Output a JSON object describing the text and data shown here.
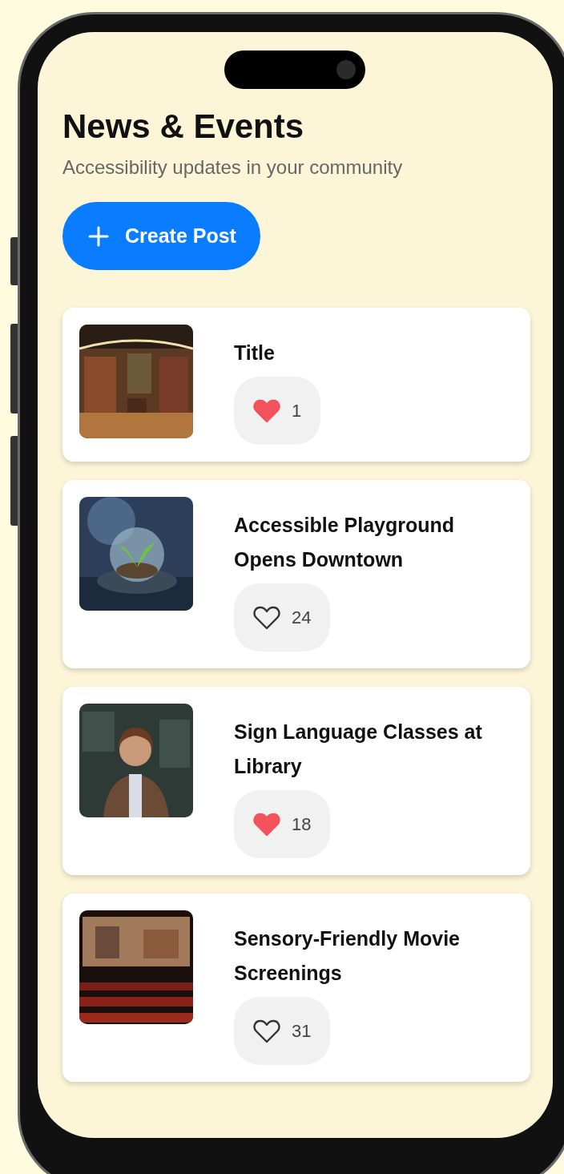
{
  "header": {
    "title": "News & Events",
    "subtitle": "Accessibility updates in your community"
  },
  "create_button": {
    "label": "Create Post"
  },
  "posts": [
    {
      "title": "Title",
      "liked": true,
      "likes": "1"
    },
    {
      "title": "Accessible Playground Opens Downtown",
      "liked": false,
      "likes": "24"
    },
    {
      "title": "Sign Language Classes at Library",
      "liked": true,
      "likes": "18"
    },
    {
      "title": "Sensory-Friendly Movie Screenings",
      "liked": false,
      "likes": "31"
    }
  ]
}
